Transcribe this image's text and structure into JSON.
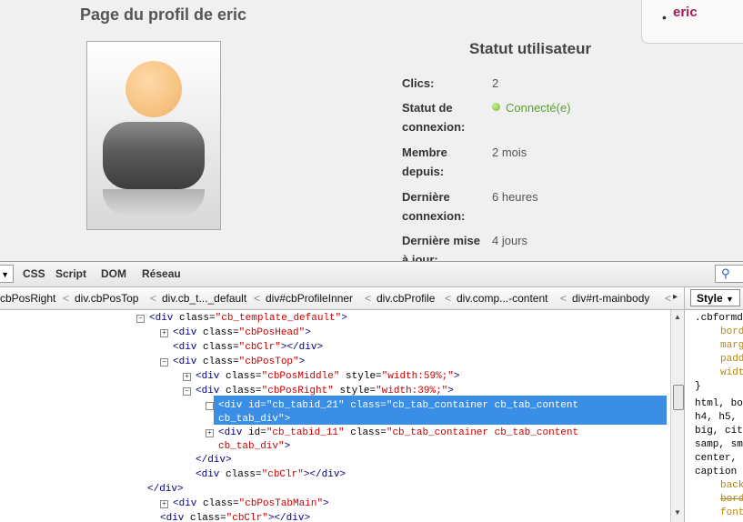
{
  "profile": {
    "page_title": "Page du profil de eric",
    "user_menu_name": "eric",
    "status_title": "Statut utilisateur",
    "stats": [
      {
        "label": "Clics:",
        "value": "2"
      },
      {
        "label": "Statut de connexion:",
        "value": "Connecté(e)"
      },
      {
        "label": "Membre depuis:",
        "value": "2 mois"
      },
      {
        "label": "Dernière connexion:",
        "value": "6 heures"
      },
      {
        "label": "Dernière mise à jour:",
        "value": "4 jours"
      }
    ]
  },
  "devtools": {
    "tabs": [
      "CSS",
      "Script",
      "DOM",
      "Réseau"
    ],
    "breadcrumbs": [
      "cbPosRight",
      "div.cbPosTop",
      "div.cb_t..._default",
      "div#cbProfileInner",
      "div.cbProfile",
      "div.comp...-content",
      "div#rt-mainbody"
    ],
    "style_label": "Style",
    "tree": [
      {
        "tag": "div",
        "attrs": [
          [
            "class",
            "cb_template_default"
          ]
        ],
        "close": false,
        "twisty": "−"
      },
      {
        "tag": "div",
        "attrs": [
          [
            "class",
            "cbPosHead"
          ]
        ],
        "close": false,
        "twisty": "+"
      },
      {
        "tag": "div",
        "attrs": [
          [
            "class",
            "cbClr"
          ]
        ],
        "close": true,
        "twisty": ""
      },
      {
        "tag": "div",
        "attrs": [
          [
            "class",
            "cbPosTop"
          ]
        ],
        "close": false,
        "twisty": "−"
      },
      {
        "tag": "div",
        "attrs": [
          [
            "class",
            "cbPosMiddle"
          ],
          [
            "style",
            "width:59%;"
          ]
        ],
        "close": false,
        "twisty": "+"
      },
      {
        "tag": "div",
        "attrs": [
          [
            "class",
            "cbPosRight"
          ],
          [
            "style",
            "width:39%;"
          ]
        ],
        "close": false,
        "twisty": "−"
      },
      {
        "tag": "div",
        "attrs": [
          [
            "id",
            "cb_tabid_21"
          ],
          [
            "class",
            "cb_tab_container cb_tab_content cb_tab_div"
          ]
        ],
        "close": false,
        "twisty": "+"
      },
      {
        "tag": "div",
        "attrs": [
          [
            "id",
            "cb_tabid_11"
          ],
          [
            "class",
            "cb_tab_container cb_tab_content cb_tab_div"
          ]
        ],
        "close": false,
        "twisty": "+"
      },
      {
        "closing": "div"
      },
      {
        "tag": "div",
        "attrs": [
          [
            "class",
            "cbClr"
          ]
        ],
        "close": true,
        "twisty": ""
      },
      {
        "closing": "div"
      },
      {
        "tag": "div",
        "attrs": [
          [
            "class",
            "cbPosTabMain"
          ]
        ],
        "close": false,
        "twisty": "+"
      },
      {
        "tag": "div",
        "attrs": [
          [
            "class",
            "cbClr"
          ]
        ],
        "close": true,
        "twisty": ""
      }
    ],
    "css_lines": [
      ".cbformd",
      "bord",
      "marg",
      "padd",
      "widt",
      "}",
      "html, bo",
      "h4, h5,",
      "big, cit",
      "samp, sm",
      "center,",
      "caption",
      "back",
      "bord",
      "font"
    ]
  }
}
